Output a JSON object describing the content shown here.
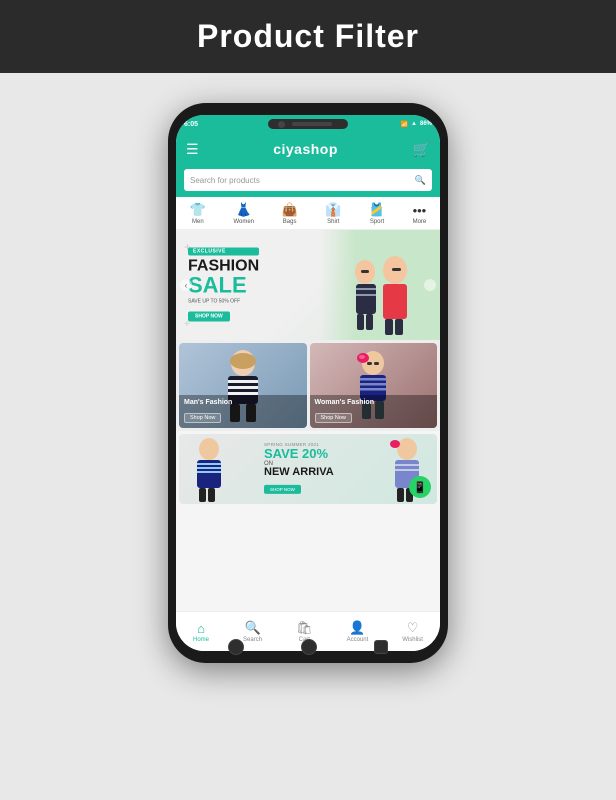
{
  "header": {
    "title": "Product Filter"
  },
  "status_bar": {
    "time": "6:05",
    "battery": "86%"
  },
  "top_nav": {
    "brand": "ciyashop",
    "menu_icon": "☰",
    "cart_icon": "🛒"
  },
  "search": {
    "placeholder": "Search for products"
  },
  "categories": [
    {
      "label": "Men",
      "icon": "👕"
    },
    {
      "label": "Women",
      "icon": "👗"
    },
    {
      "label": "Bags",
      "icon": "👜"
    },
    {
      "label": "Shirt",
      "icon": "👔"
    },
    {
      "label": "Sport",
      "icon": "🎽"
    },
    {
      "label": "More",
      "icon": "···"
    }
  ],
  "banner": {
    "exclusive_tag": "EXCLUSIVE",
    "title": "FASHION",
    "sale": "SALE",
    "subtitle": "SAVE UP TO 50% OFF",
    "button": "SHOP NOW"
  },
  "fashion_cards": [
    {
      "title": "Man's Fashion",
      "shop": "Shop Now"
    },
    {
      "title": "Woman's Fashion",
      "shop": "Shop Now"
    }
  ],
  "save_banner": {
    "spring_text": "SPRING SUMMER 2021",
    "save_text": "SAVE 20%",
    "on_text": "ON",
    "arrivals_text": "NEW ARRIVA",
    "shop_btn": "SHOP NOW"
  },
  "bottom_nav": [
    {
      "label": "Home",
      "icon": "🏠",
      "active": true
    },
    {
      "label": "Search",
      "icon": "🔍",
      "active": false
    },
    {
      "label": "Cart",
      "icon": "🛍",
      "active": false
    },
    {
      "label": "Account",
      "icon": "👤",
      "active": false
    },
    {
      "label": "Wishlist",
      "icon": "♡",
      "active": false
    }
  ]
}
